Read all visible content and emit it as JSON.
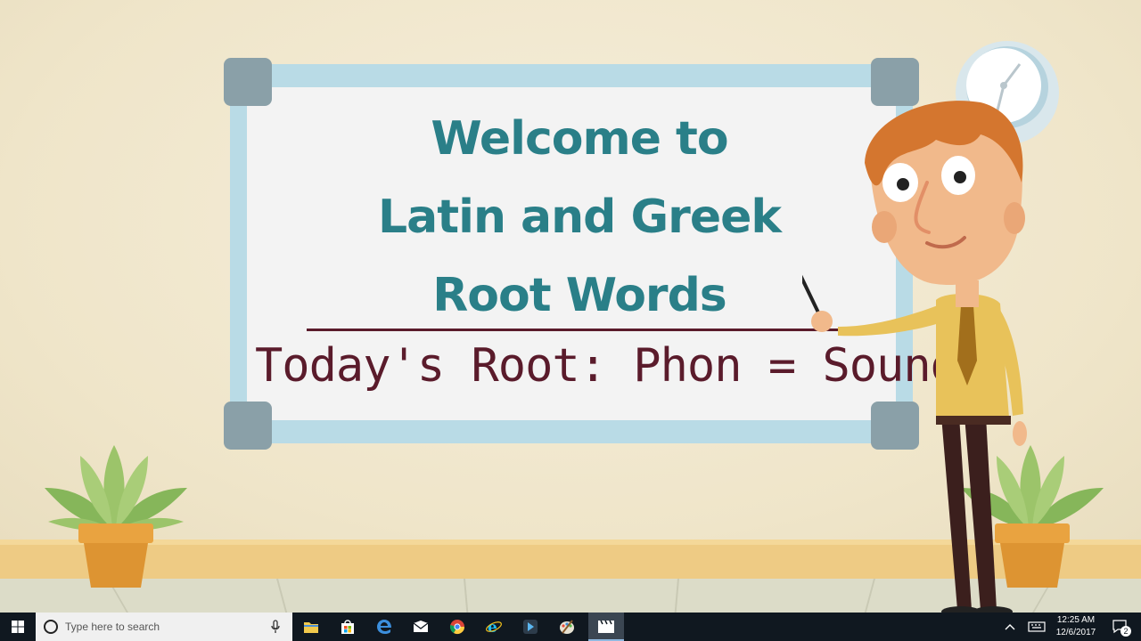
{
  "board": {
    "title_lines": [
      "Welcome to",
      "Latin and Greek",
      "Root Words"
    ],
    "subtitle": "Today's Root: Phon = Sound"
  },
  "taskbar": {
    "search_placeholder": "Type here to search",
    "time": "12:25 AM",
    "date": "12/6/2017",
    "notification_count": "2",
    "pinned_apps": [
      "file-explorer-icon",
      "store-icon",
      "edge-icon",
      "mail-icon",
      "chrome-icon",
      "internet-explorer-icon",
      "media-app-icon",
      "paint-icon",
      "video-editor-icon"
    ]
  },
  "colors": {
    "title_teal": "#2a7f88",
    "subtitle_maroon": "#5a1b2b",
    "taskbar": "#101820"
  }
}
